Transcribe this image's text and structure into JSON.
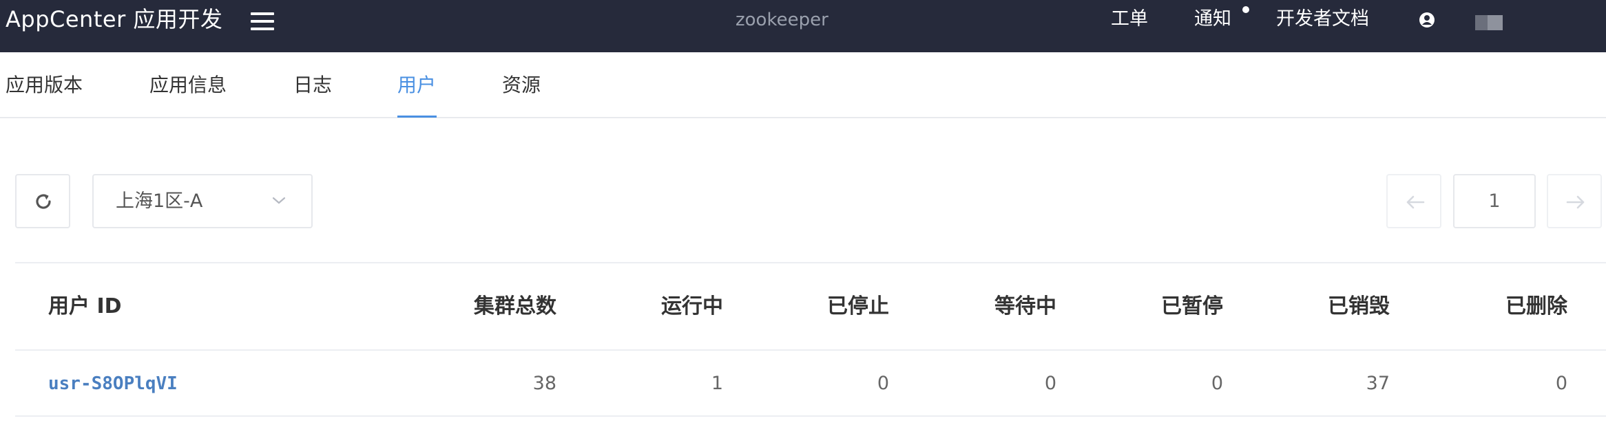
{
  "header": {
    "brand": "AppCenter 应用开发",
    "app_name": "zookeeper",
    "nav": [
      "工单",
      "通知",
      "开发者文档"
    ],
    "menu_icon": "hamburger-menu-icon",
    "user_icon": "user-circle-icon"
  },
  "tabs": [
    {
      "label": "应用版本"
    },
    {
      "label": "应用信息"
    },
    {
      "label": "日志"
    },
    {
      "label": "用户",
      "active": true
    },
    {
      "label": "资源"
    }
  ],
  "toolbar": {
    "refresh_icon": "refresh-icon",
    "zone": "上海1区-A",
    "page": "1"
  },
  "table": {
    "headers": [
      "用户 ID",
      "集群总数",
      "运行中",
      "已停止",
      "等待中",
      "已暂停",
      "已销毁",
      "已删除"
    ],
    "rows": [
      [
        "usr-S8OPlqVI",
        "38",
        "1",
        "0",
        "0",
        "0",
        "37",
        "0"
      ]
    ]
  },
  "colors": {
    "topbar": "#262a3b",
    "accent": "#4a90e2",
    "link": "#4a7fc0"
  }
}
